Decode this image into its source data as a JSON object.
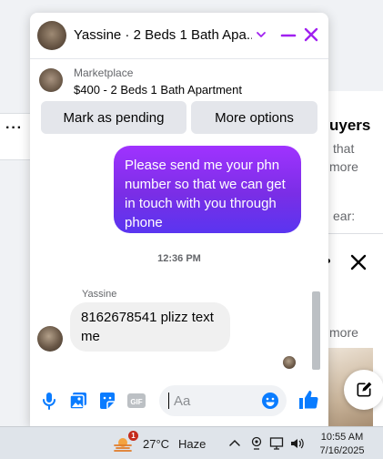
{
  "background": {
    "right_heading": "uyers",
    "right_line1": "that",
    "right_line2": "more",
    "right_line3": "ear:",
    "right_more": "more"
  },
  "chat": {
    "title": "Yassine · 2 Beds 1 Bath Apa...",
    "listing": {
      "category": "Marketplace",
      "title": "$400 - 2 Beds 1 Bath Apartment"
    },
    "actions": {
      "pending_label": "Mark as pending",
      "more_label": "More options"
    },
    "messages": {
      "sent_text": "Please send me your phn number so that we can get in touch with you through phone",
      "timestamp": "12:36 PM",
      "sender_name": "Yassine",
      "received_text": "8162678541 plizz text me"
    },
    "composer": {
      "placeholder": "Aa"
    },
    "accent_color": "#a020f0",
    "icon_color": "#0a7cff"
  },
  "taskbar": {
    "weather_badge": "1",
    "temperature": "27°C",
    "condition": "Haze",
    "time": "10:55 AM",
    "date": "7/16/2025"
  }
}
